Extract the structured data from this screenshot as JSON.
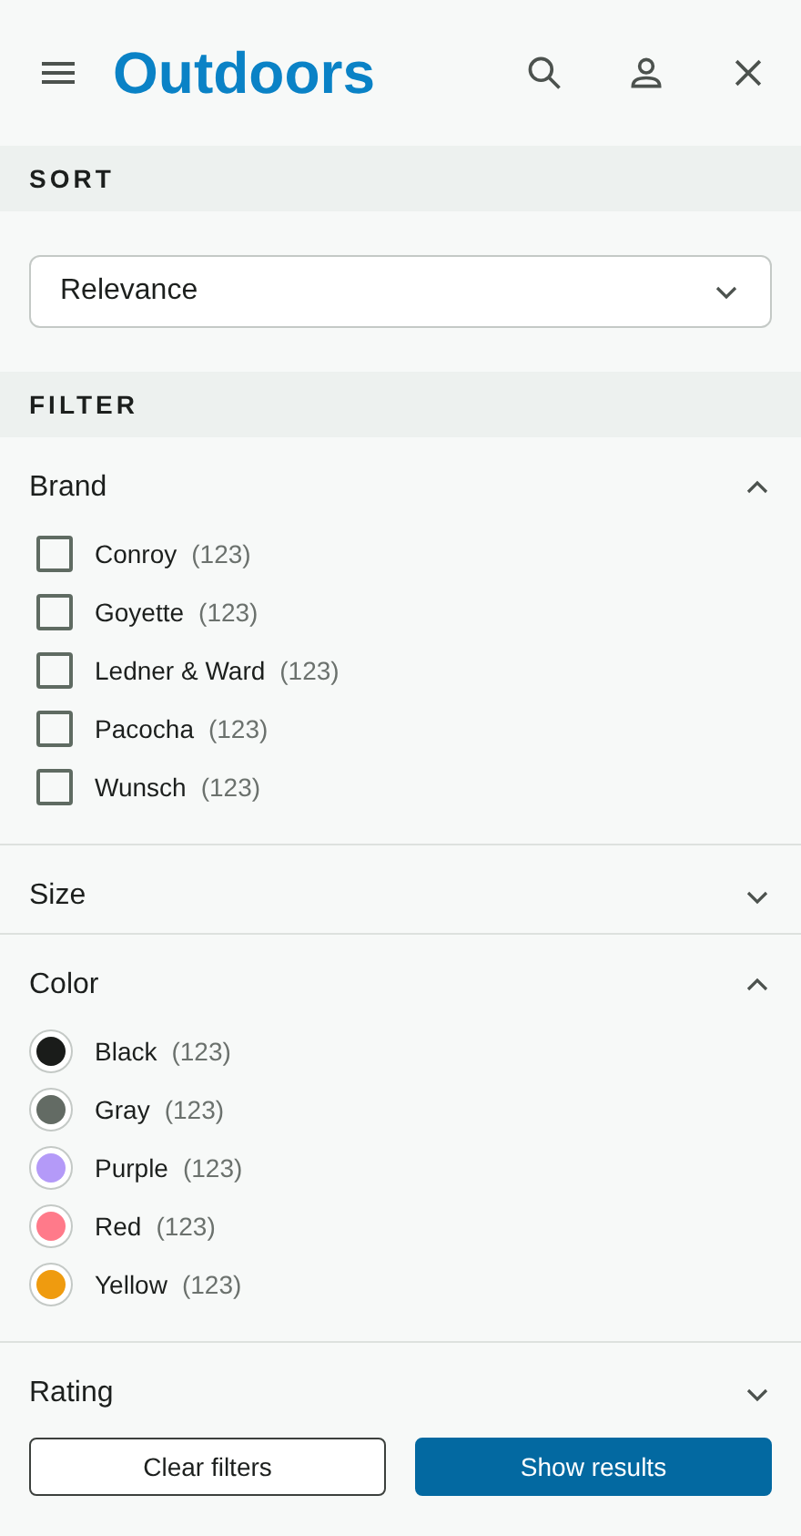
{
  "header": {
    "title": "Outdoors"
  },
  "sort": {
    "heading": "SORT",
    "value": "Relevance"
  },
  "filter": {
    "heading": "FILTER",
    "sections": [
      {
        "title": "Brand",
        "expanded": true,
        "kind": "checkbox",
        "options": [
          {
            "label": "Conroy",
            "count": "(123)",
            "checked": false
          },
          {
            "label": "Goyette",
            "count": "(123)",
            "checked": false
          },
          {
            "label": "Ledner & Ward",
            "count": "(123)",
            "checked": false
          },
          {
            "label": "Pacocha",
            "count": "(123)",
            "checked": false
          },
          {
            "label": "Wunsch",
            "count": "(123)",
            "checked": false
          }
        ]
      },
      {
        "title": "Size",
        "expanded": false
      },
      {
        "title": "Color",
        "expanded": true,
        "kind": "swatch",
        "options": [
          {
            "label": "Black",
            "count": "(123)",
            "color": "#1a1c1a"
          },
          {
            "label": "Gray",
            "count": "(123)",
            "color": "#636b64"
          },
          {
            "label": "Purple",
            "count": "(123)",
            "color": "#b49af8"
          },
          {
            "label": "Red",
            "count": "(123)",
            "color": "#ff7a8a"
          },
          {
            "label": "Yellow",
            "count": "(123)",
            "color": "#ef9b0f"
          }
        ]
      },
      {
        "title": "Rating",
        "expanded": false
      }
    ]
  },
  "footer": {
    "buttons": [
      {
        "label": "Clear filters",
        "kind": "secondary"
      },
      {
        "label": "Show results",
        "kind": "primary"
      }
    ]
  }
}
